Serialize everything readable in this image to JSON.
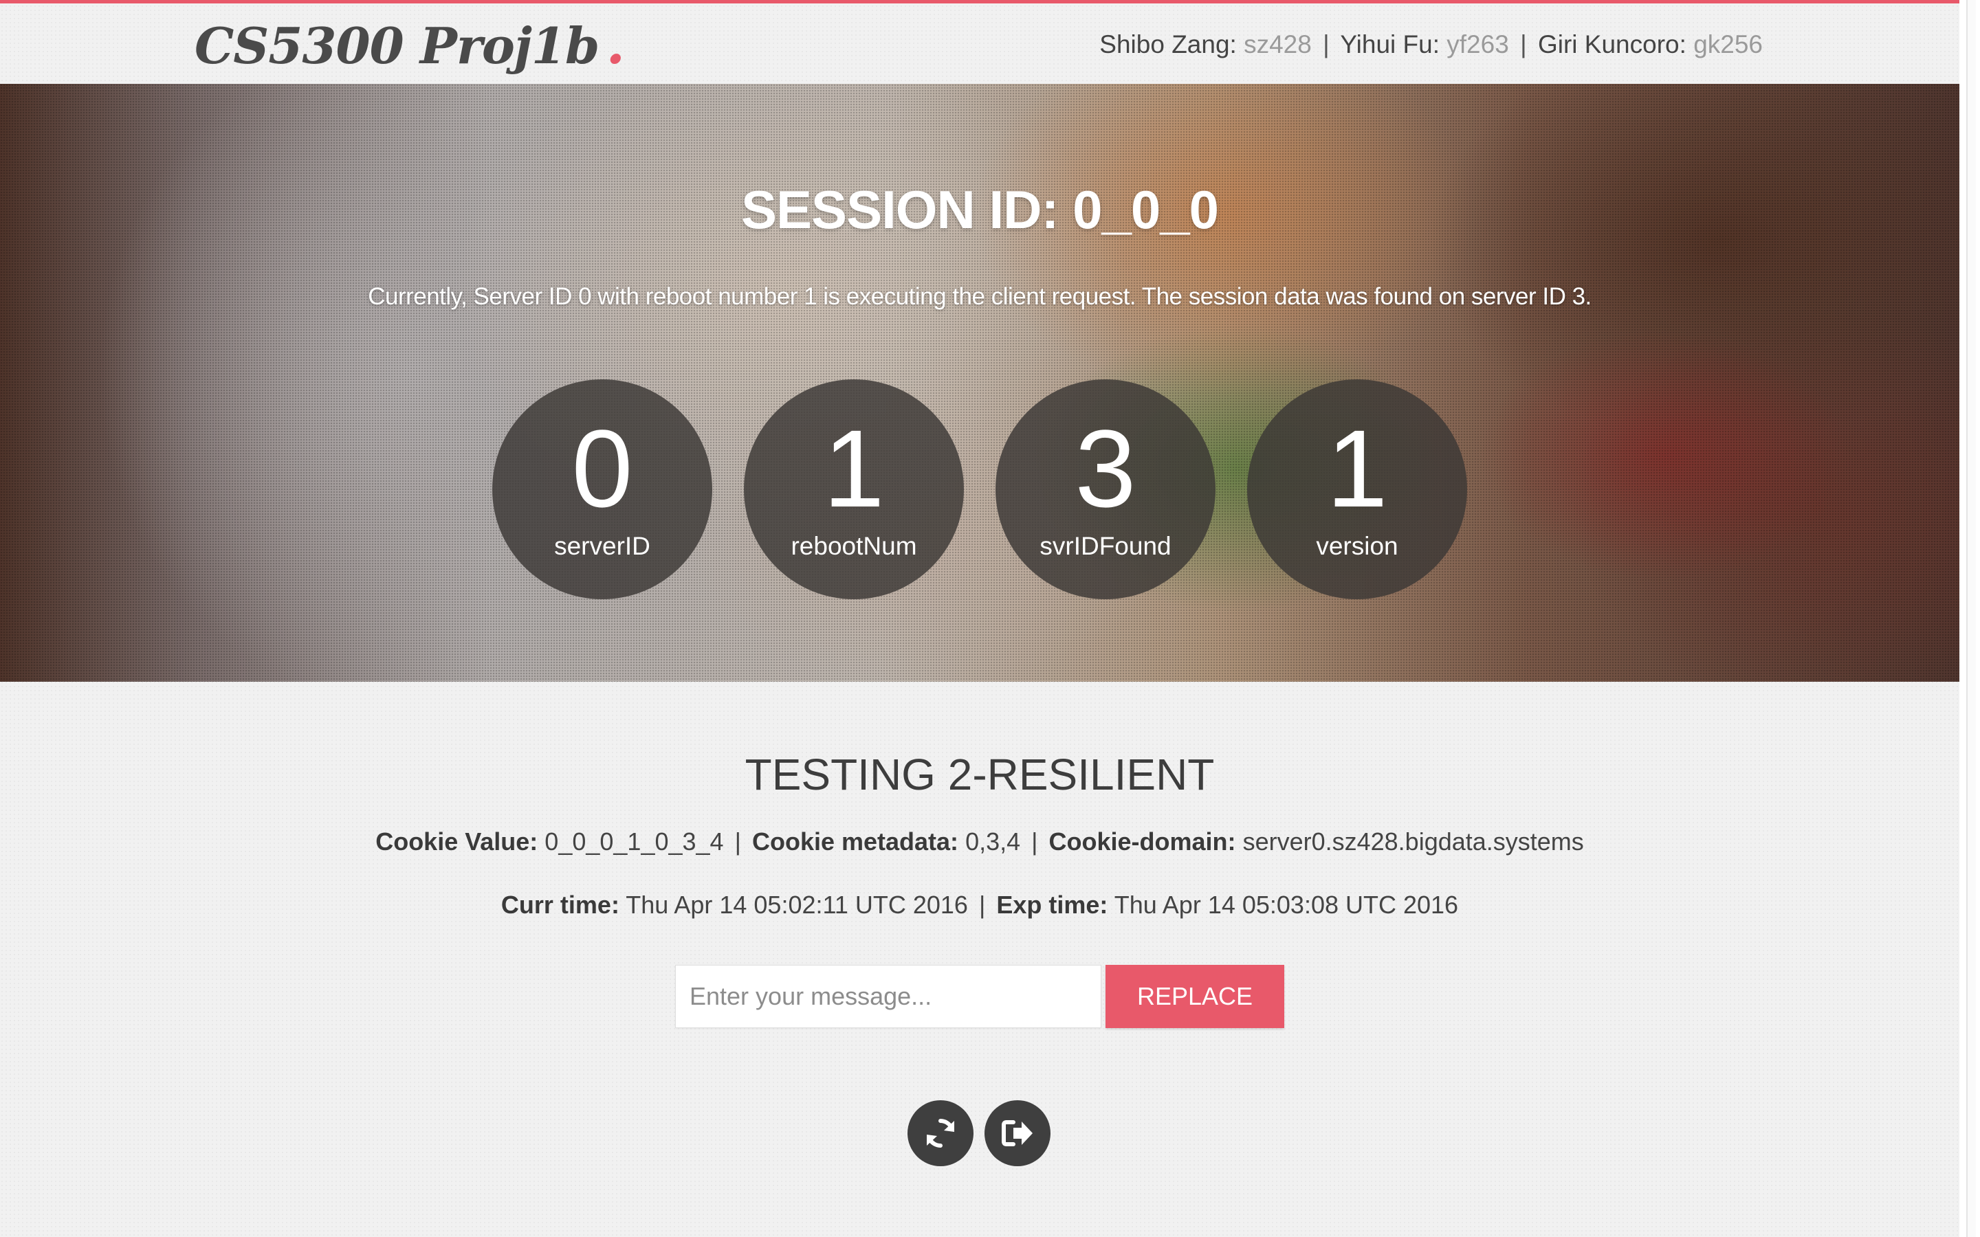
{
  "header": {
    "logo": "CS5300 Proj1b",
    "logo_dot": ".",
    "authors": [
      {
        "name": "Shibo Zang:",
        "netid": "sz428"
      },
      {
        "name": "Yihui Fu:",
        "netid": "yf263"
      },
      {
        "name": "Giri Kuncoro:",
        "netid": "gk256"
      }
    ],
    "separator": "|"
  },
  "hero": {
    "session_title": "SESSION ID: 0_0_0",
    "description": "Currently, Server ID 0 with reboot number 1 is executing the client request. The session data was found on server ID 3.",
    "stats": [
      {
        "value": "0",
        "label": "serverID"
      },
      {
        "value": "1",
        "label": "rebootNum"
      },
      {
        "value": "3",
        "label": "svrIDFound"
      },
      {
        "value": "1",
        "label": "version"
      }
    ]
  },
  "testing": {
    "title": "TESTING 2-RESILIENT",
    "cookie_value_label": "Cookie Value:",
    "cookie_value": "0_0_0_1_0_3_4",
    "cookie_metadata_label": "Cookie metadata:",
    "cookie_metadata": "0,3,4",
    "cookie_domain_label": "Cookie-domain:",
    "cookie_domain": "server0.sz428.bigdata.systems",
    "curr_time_label": "Curr time:",
    "curr_time": "Thu Apr 14 05:02:11 UTC 2016",
    "exp_time_label": "Exp time:",
    "exp_time": "Thu Apr 14 05:03:08 UTC 2016",
    "separator": "|"
  },
  "form": {
    "message_placeholder": "Enter your message...",
    "message_value": "",
    "replace_label": "REPLACE"
  },
  "actions": {
    "refresh_icon": "refresh-icon",
    "logout_icon": "sign-out-icon"
  },
  "colors": {
    "accent": "#e8596a",
    "circle_bg": "#3c3836",
    "text_dark": "#3d3d3d",
    "netid_gray": "#9a9a9a"
  }
}
